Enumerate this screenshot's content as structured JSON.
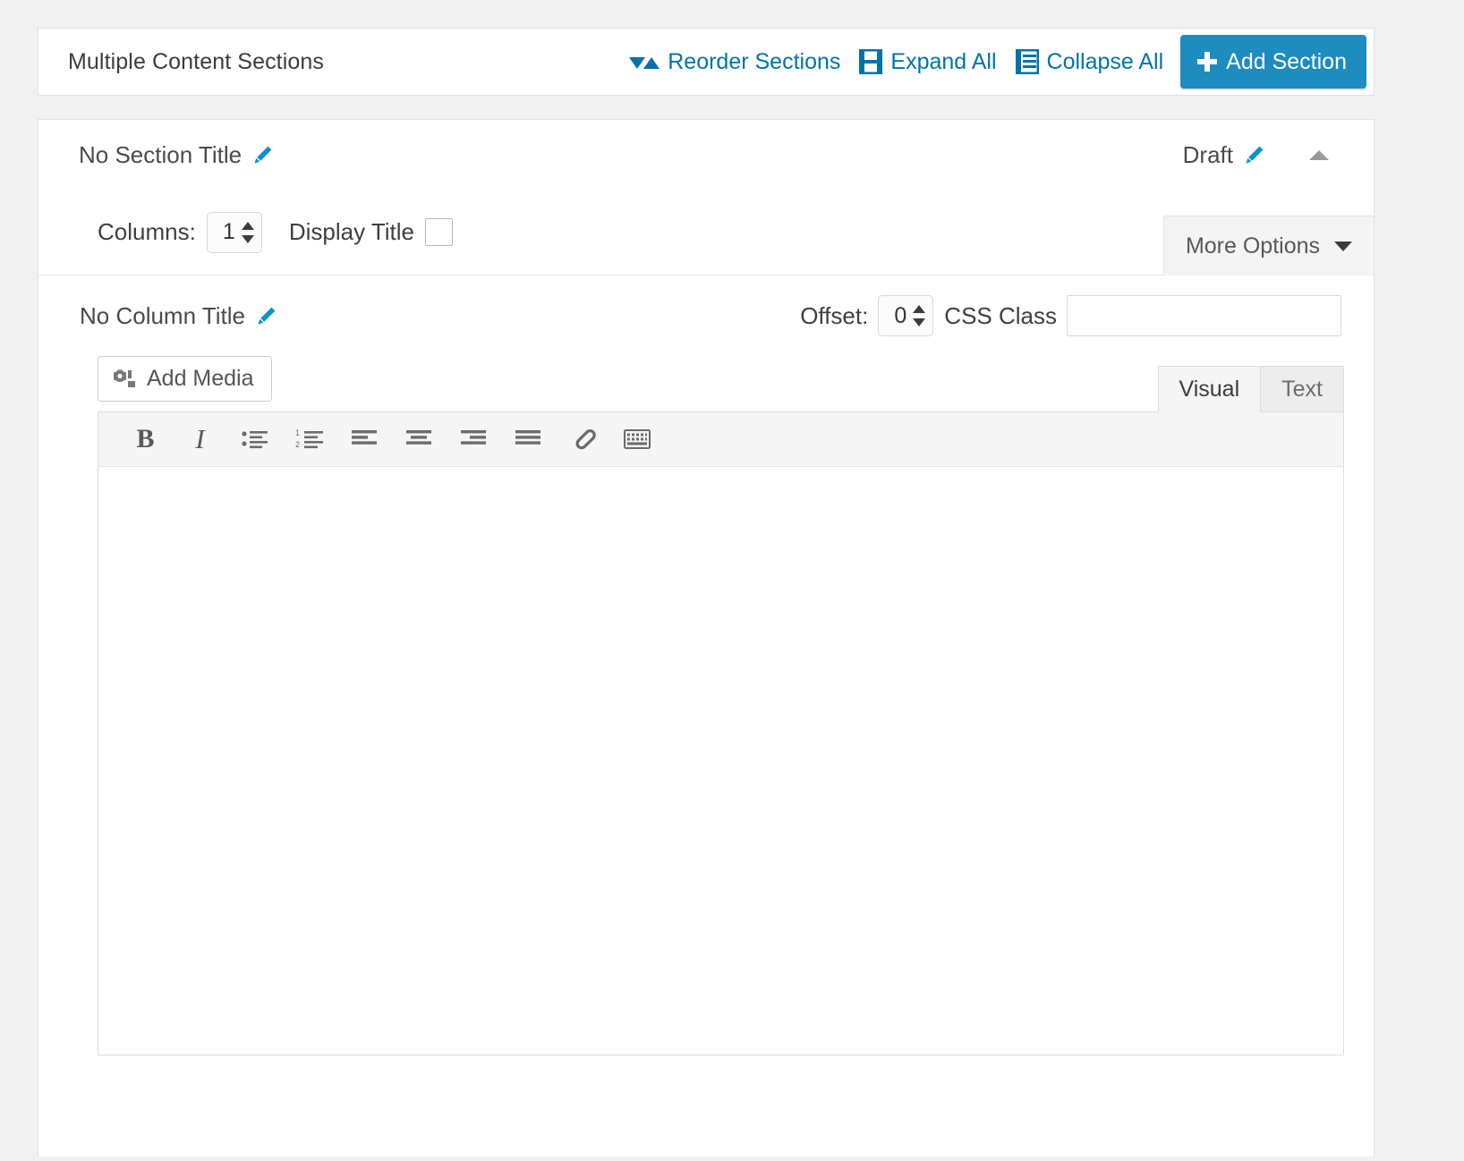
{
  "header": {
    "title": "Multiple Content Sections",
    "tools": [
      {
        "label": "Reorder Sections",
        "icon": "reorder-icon"
      },
      {
        "label": "Expand All",
        "icon": "expand-all-icon"
      },
      {
        "label": "Collapse All",
        "icon": "collapse-all-icon"
      }
    ],
    "add_section_label": "Add Section",
    "accent_color": "#1e8cbe",
    "link_color": "#0073aa"
  },
  "section": {
    "title": "No Section Title",
    "edit_icon": "pencil-icon",
    "status": "Draft",
    "status_edit_icon": "pencil-icon",
    "collapse_icon": "caret-up-icon",
    "options": {
      "columns_label": "Columns:",
      "columns_value": "1",
      "display_title_label": "Display Title",
      "display_title_checked": false,
      "more_options_label": "More Options",
      "more_options_caret": "chevron-down-icon"
    },
    "column": {
      "title": "No Column Title",
      "edit_icon": "pencil-icon",
      "offset_label": "Offset:",
      "offset_value": "0",
      "css_class_label": "CSS Class",
      "css_class_value": "",
      "css_class_placeholder": ""
    },
    "editor": {
      "add_media_label": "Add Media",
      "add_media_icon": "media-icon",
      "tabs": [
        {
          "label": "Visual",
          "active": true
        },
        {
          "label": "Text",
          "active": false
        }
      ],
      "toolbar": [
        {
          "name": "bold-icon",
          "glyph": "B"
        },
        {
          "name": "italic-icon",
          "glyph": "I"
        },
        {
          "name": "bulleted-list-icon",
          "glyph": ""
        },
        {
          "name": "numbered-list-icon",
          "glyph": ""
        },
        {
          "name": "align-left-icon",
          "glyph": ""
        },
        {
          "name": "align-center-icon",
          "glyph": ""
        },
        {
          "name": "align-right-icon",
          "glyph": ""
        },
        {
          "name": "align-justify-icon",
          "glyph": ""
        },
        {
          "name": "link-icon",
          "glyph": ""
        },
        {
          "name": "toolbar-toggle-icon",
          "glyph": ""
        }
      ],
      "content": ""
    }
  }
}
